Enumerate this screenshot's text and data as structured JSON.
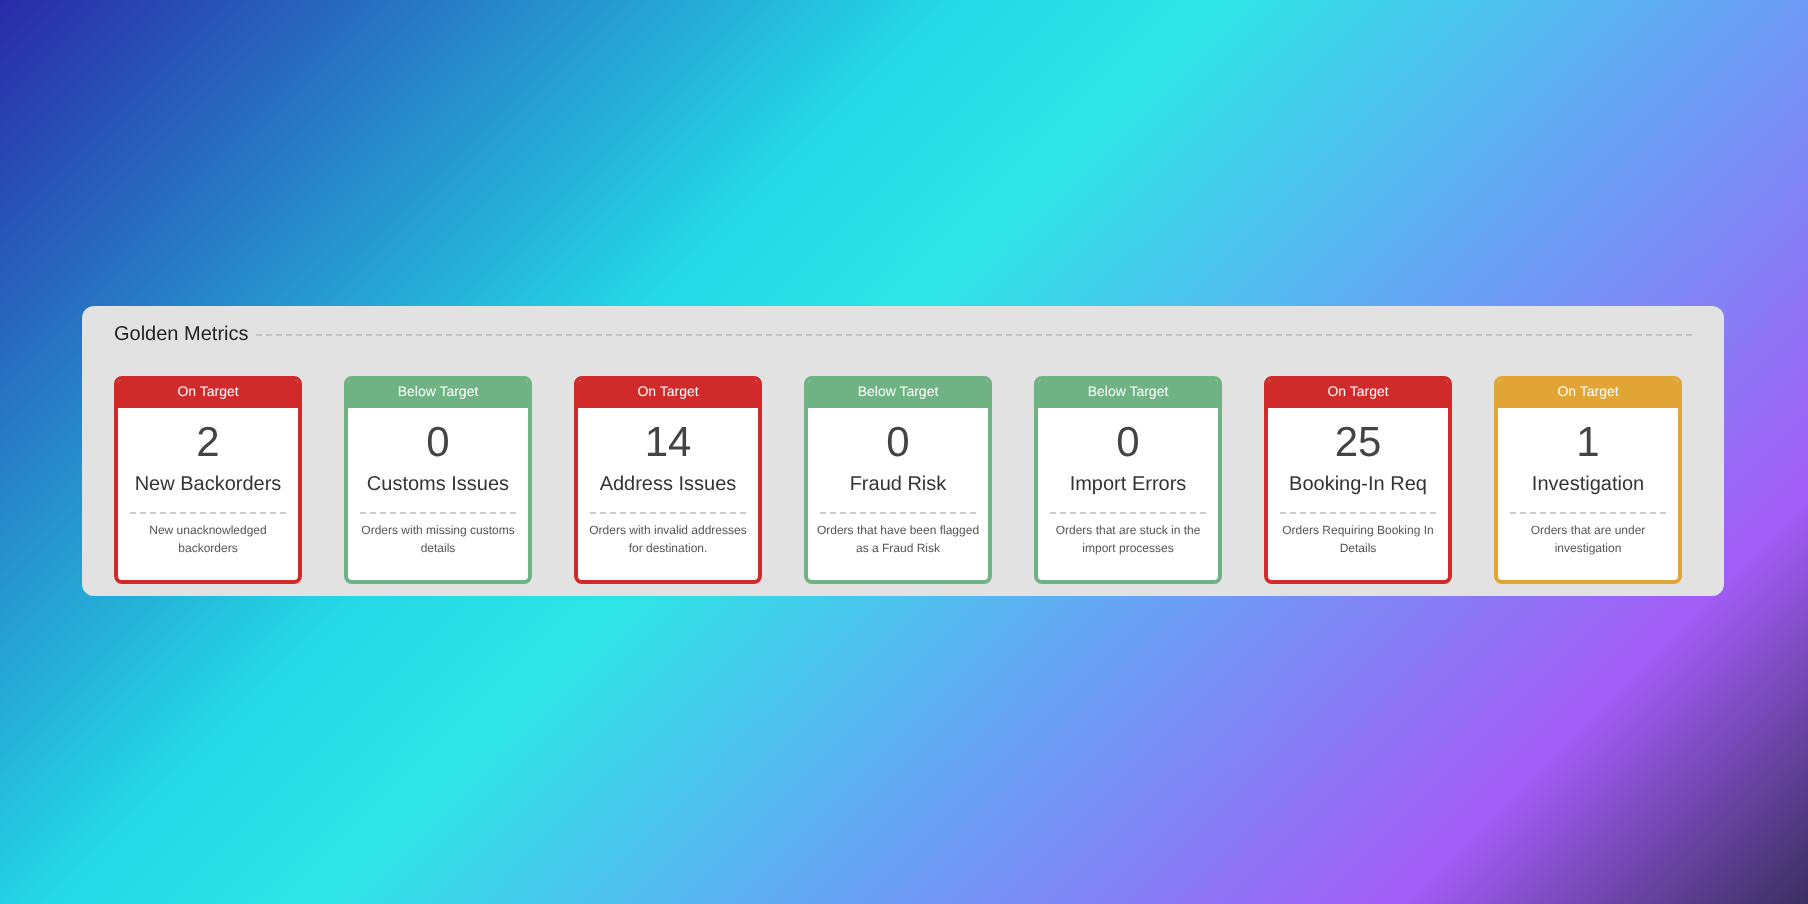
{
  "panel": {
    "title": "Golden Metrics"
  },
  "cards": [
    {
      "status": "On Target",
      "color": "#d12a2a",
      "value": "2",
      "title": "New Backorders",
      "description": "New unacknowledged backorders"
    },
    {
      "status": "Below Target",
      "color": "#6fb283",
      "value": "0",
      "title": "Customs Issues",
      "description": "Orders with missing customs details"
    },
    {
      "status": "On Target",
      "color": "#d12a2a",
      "value": "14",
      "title": "Address Issues",
      "description": "Orders with invalid addresses for destination."
    },
    {
      "status": "Below Target",
      "color": "#6fb283",
      "value": "0",
      "title": "Fraud Risk",
      "description": "Orders that have been flagged as a Fraud Risk"
    },
    {
      "status": "Below Target",
      "color": "#6fb283",
      "value": "0",
      "title": "Import Errors",
      "description": "Orders that are stuck in the import processes"
    },
    {
      "status": "On Target",
      "color": "#d12a2a",
      "value": "25",
      "title": "Booking-In Req",
      "description": "Orders Requiring Booking In Details"
    },
    {
      "status": "On Target",
      "color": "#e0a535",
      "value": "1",
      "title": "Investigation",
      "description": "Orders that are under investigation"
    }
  ]
}
